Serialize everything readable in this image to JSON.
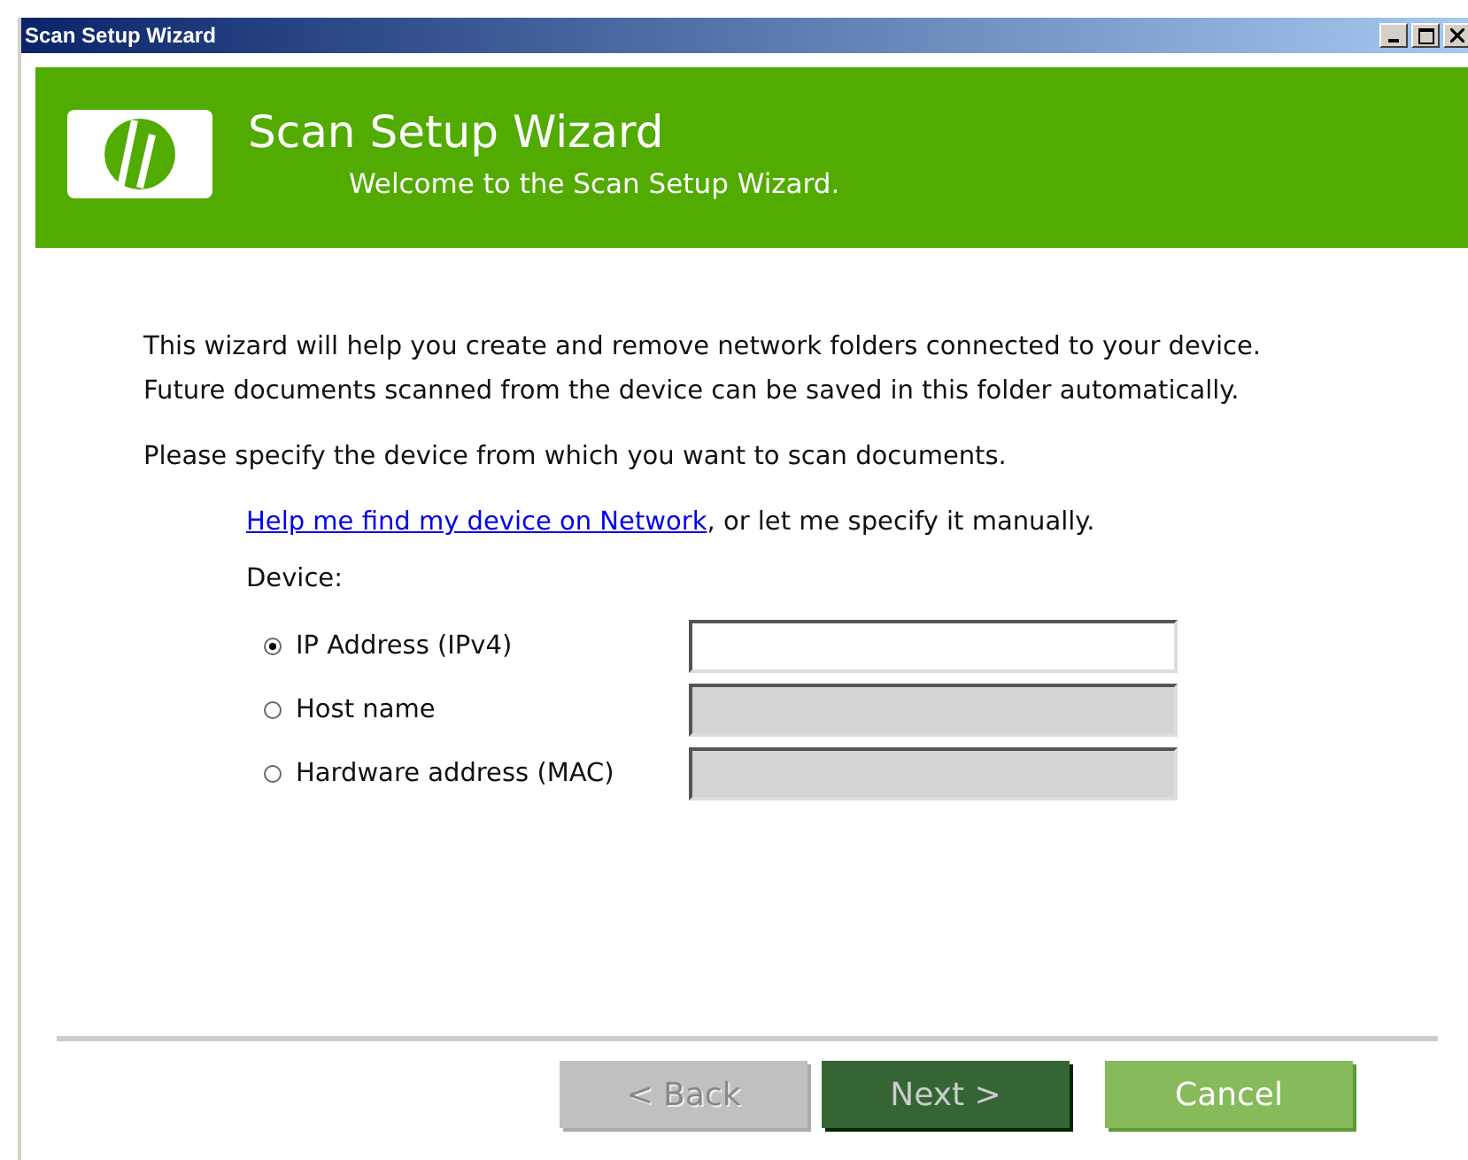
{
  "window": {
    "title": "Scan Setup Wizard"
  },
  "header": {
    "title": "Scan Setup Wizard",
    "subtitle": "Welcome to the Scan Setup Wizard."
  },
  "intro": "This wizard will help you create and remove network folders connected to your device. Future documents scanned from the device can be saved in this folder automatically.",
  "prompt": "Please specify the device from which you want to scan documents.",
  "help": {
    "link": "Help me find my device on Network",
    "rest": ", or let me specify it manually."
  },
  "device_label": "Device:",
  "options": [
    {
      "label": "IP Address (IPv4)",
      "selected": true,
      "disabled": false
    },
    {
      "label": "Host name",
      "selected": false,
      "disabled": true
    },
    {
      "label": "Hardware address (MAC)",
      "selected": false,
      "disabled": true
    }
  ],
  "buttons": [
    {
      "label": "< Back",
      "kind": "back",
      "disabled": true
    },
    {
      "label": "Next >",
      "kind": "default",
      "disabled": false
    },
    {
      "label": "Cancel",
      "kind": "normal",
      "disabled": false
    }
  ]
}
